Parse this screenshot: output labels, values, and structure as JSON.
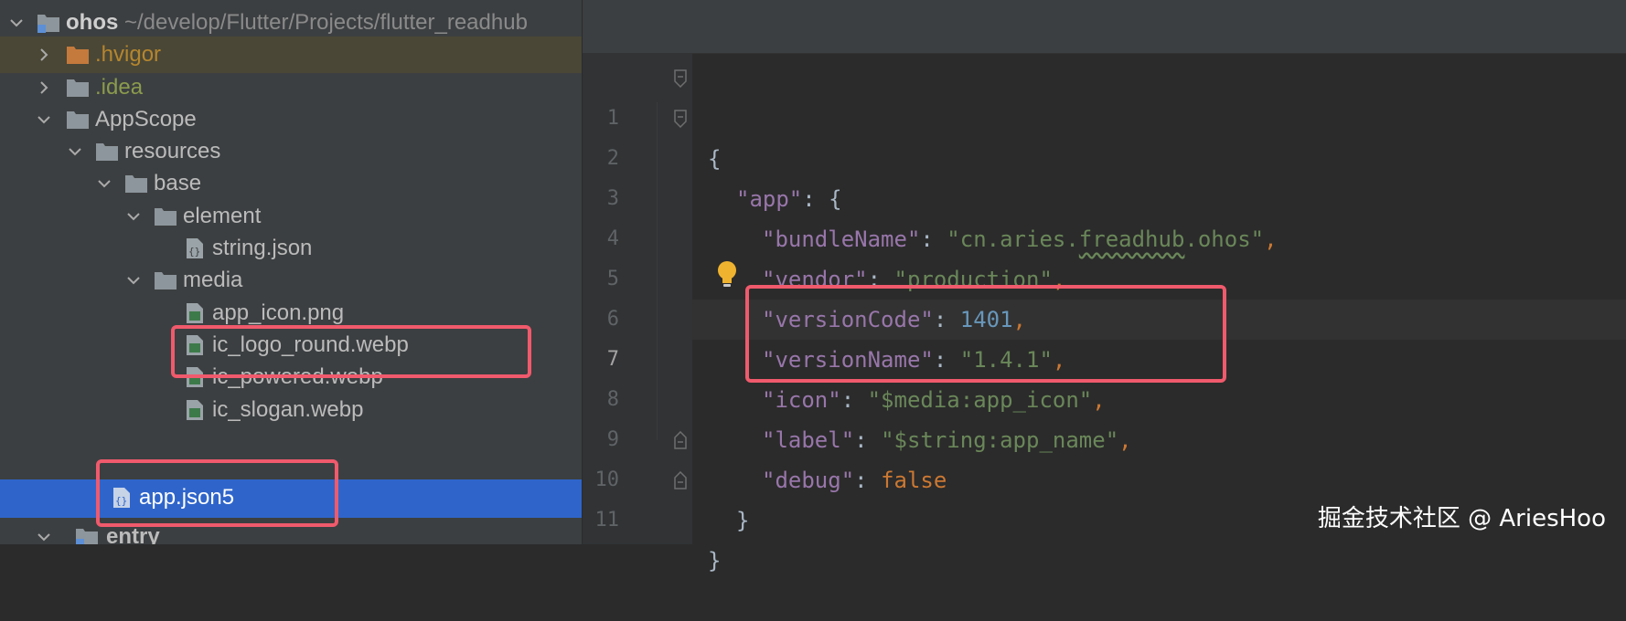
{
  "tree": {
    "root_name": "ohos",
    "root_path": "~/develop/Flutter/Projects/flutter_readhub",
    "items": [
      {
        "label": ".hvigor"
      },
      {
        "label": ".idea"
      },
      {
        "label": "AppScope"
      },
      {
        "label": "resources"
      },
      {
        "label": "base"
      },
      {
        "label": "element"
      },
      {
        "label": "string.json"
      },
      {
        "label": "media"
      },
      {
        "label": "app_icon.png"
      },
      {
        "label": "ic_logo_round.webp"
      },
      {
        "label": "ic_powered.webp"
      },
      {
        "label": "ic_slogan.webp"
      },
      {
        "label": "app.json5"
      },
      {
        "label": "entry"
      }
    ]
  },
  "editor": {
    "line_numbers": [
      "1",
      "2",
      "3",
      "4",
      "5",
      "6",
      "7",
      "8",
      "9",
      "10",
      "11"
    ],
    "current_line": "7",
    "code": {
      "l1": "{",
      "l2_key": "\"app\"",
      "l2_rest": ": {",
      "l3_key": "\"bundleName\"",
      "l3_colon": ": ",
      "l3_val_a": "\"cn.aries.",
      "l3_val_b": "freadhub",
      "l3_val_c": ".ohos\"",
      "l3_comma": ",",
      "l4_key": "\"vendor\"",
      "l4_colon": ": ",
      "l4_val": "\"production\"",
      "l4_comma": ",",
      "l5_key": "\"versionCode\"",
      "l5_colon": ": ",
      "l5_val": "1401",
      "l5_comma": ",",
      "l6_key": "\"versionName\"",
      "l6_colon": ": ",
      "l6_val": "\"1.4.1\"",
      "l6_comma": ",",
      "l7_key": "\"icon\"",
      "l7_colon": ": ",
      "l7_val": "\"$media:app_icon\"",
      "l7_comma": ",",
      "l8_key": "\"label\"",
      "l8_colon": ": ",
      "l8_val": "\"$string:app_name\"",
      "l8_comma": ",",
      "l9_key": "\"debug\"",
      "l9_colon": ": ",
      "l9_val": "false",
      "l10": "}",
      "l11": "}"
    }
  },
  "watermark": "掘金技术社区 @ AriesHoo",
  "colors": {
    "annotation": "#f05a6c",
    "selection": "#2f65ca",
    "key": "#9876aa",
    "string": "#6a8759",
    "number": "#6897bb",
    "keyword": "#cc7832"
  }
}
